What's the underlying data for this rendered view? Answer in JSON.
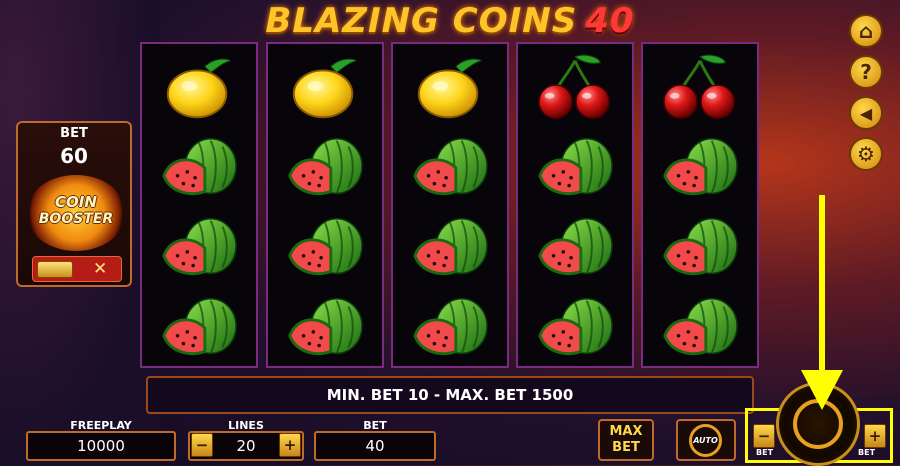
{
  "game": {
    "title_part1": "BLAZING COINS",
    "title_part2": "40"
  },
  "reels": [
    [
      "lemon",
      "watermelon",
      "watermelon",
      "watermelon"
    ],
    [
      "lemon",
      "watermelon",
      "watermelon",
      "watermelon"
    ],
    [
      "lemon",
      "watermelon",
      "watermelon",
      "watermelon"
    ],
    [
      "cherries",
      "watermelon",
      "watermelon",
      "watermelon"
    ],
    [
      "cherries",
      "watermelon",
      "watermelon",
      "watermelon"
    ]
  ],
  "message": "MIN. BET 10 - MAX. BET 1500",
  "bet_panel": {
    "label": "BET",
    "value": "60",
    "booster_line1": "COIN",
    "booster_line2": "BOOSTER",
    "toggle_state": "✕"
  },
  "side_buttons": [
    "home-icon",
    "help-icon",
    "sound-off-icon",
    "settings-icon"
  ],
  "bottom": {
    "freeplay_label": "FREEPLAY",
    "freeplay_value": "10000",
    "lines_label": "LINES",
    "lines_value": "20",
    "bet_label": "BET",
    "bet_value": "40",
    "minus": "−",
    "plus": "+",
    "max_bet_line1": "MAX",
    "max_bet_line2": "BET",
    "auto_label": "AUTO",
    "spin_minus_label": "BET",
    "spin_plus_label": "BET"
  },
  "colors": {
    "accent": "#ffc42a",
    "highlight": "#ffff00",
    "reel_border": "#7a2a80"
  }
}
